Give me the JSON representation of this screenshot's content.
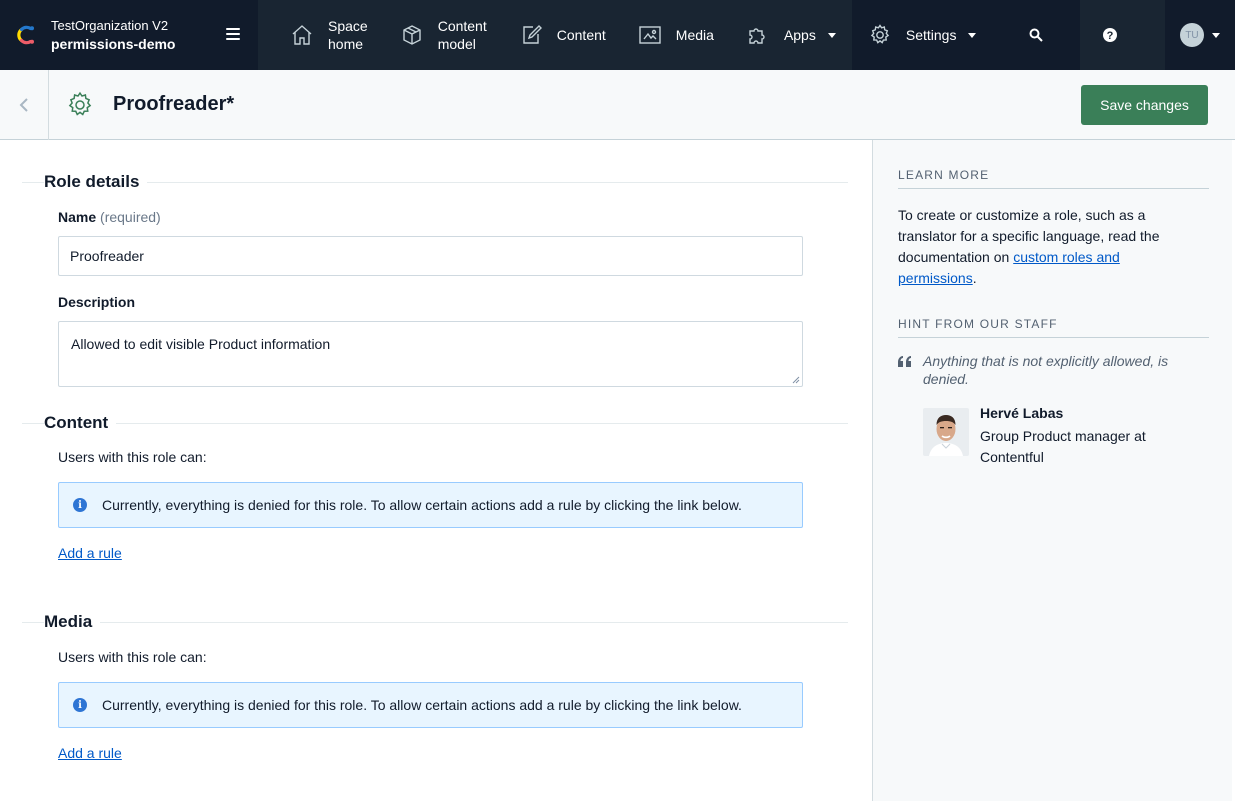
{
  "org": {
    "name": "TestOrganization V2",
    "space": "permissions-demo"
  },
  "nav": {
    "space_home": [
      "Space",
      "home"
    ],
    "content_model": [
      "Content",
      "model"
    ],
    "content": "Content",
    "media": "Media",
    "apps": "Apps",
    "settings": "Settings",
    "user_initials": "TU"
  },
  "header": {
    "title": "Proofreader*",
    "save_label": "Save changes"
  },
  "role_details": {
    "title": "Role details",
    "name_label": "Name",
    "name_required": "(required)",
    "name_value": "Proofreader",
    "description_label": "Description",
    "description_value": "Allowed to edit visible Product information"
  },
  "content_section": {
    "title": "Content",
    "intro": "Users with this role can:",
    "note": "Currently, everything is denied for this role. To allow certain actions add a rule by clicking the link below.",
    "add_rule": "Add a rule"
  },
  "media_section": {
    "title": "Media",
    "intro": "Users with this role can:",
    "note": "Currently, everything is denied for this role. To allow certain actions add a rule by clicking the link below.",
    "add_rule": "Add a rule"
  },
  "sidebar": {
    "learn_more_heading": "LEARN MORE",
    "learn_more_text": "To create or customize a role, such as a translator for a specific language, read the documentation on ",
    "learn_more_link": "custom roles and permissions",
    "learn_more_end": ".",
    "hint_heading": "HINT FROM OUR STAFF",
    "hint_quote": "Anything that is not explicitly allowed, is denied.",
    "staff_name": "Hervé Labas",
    "staff_role": "Group Product manager at Contentful"
  },
  "colors": {
    "topbar": "#192532",
    "topbar_dark": "#111b2b",
    "primary_button": "#3a7f58",
    "link": "#0059c8",
    "note_bg": "#e8f5ff",
    "note_border": "#98cbff"
  }
}
